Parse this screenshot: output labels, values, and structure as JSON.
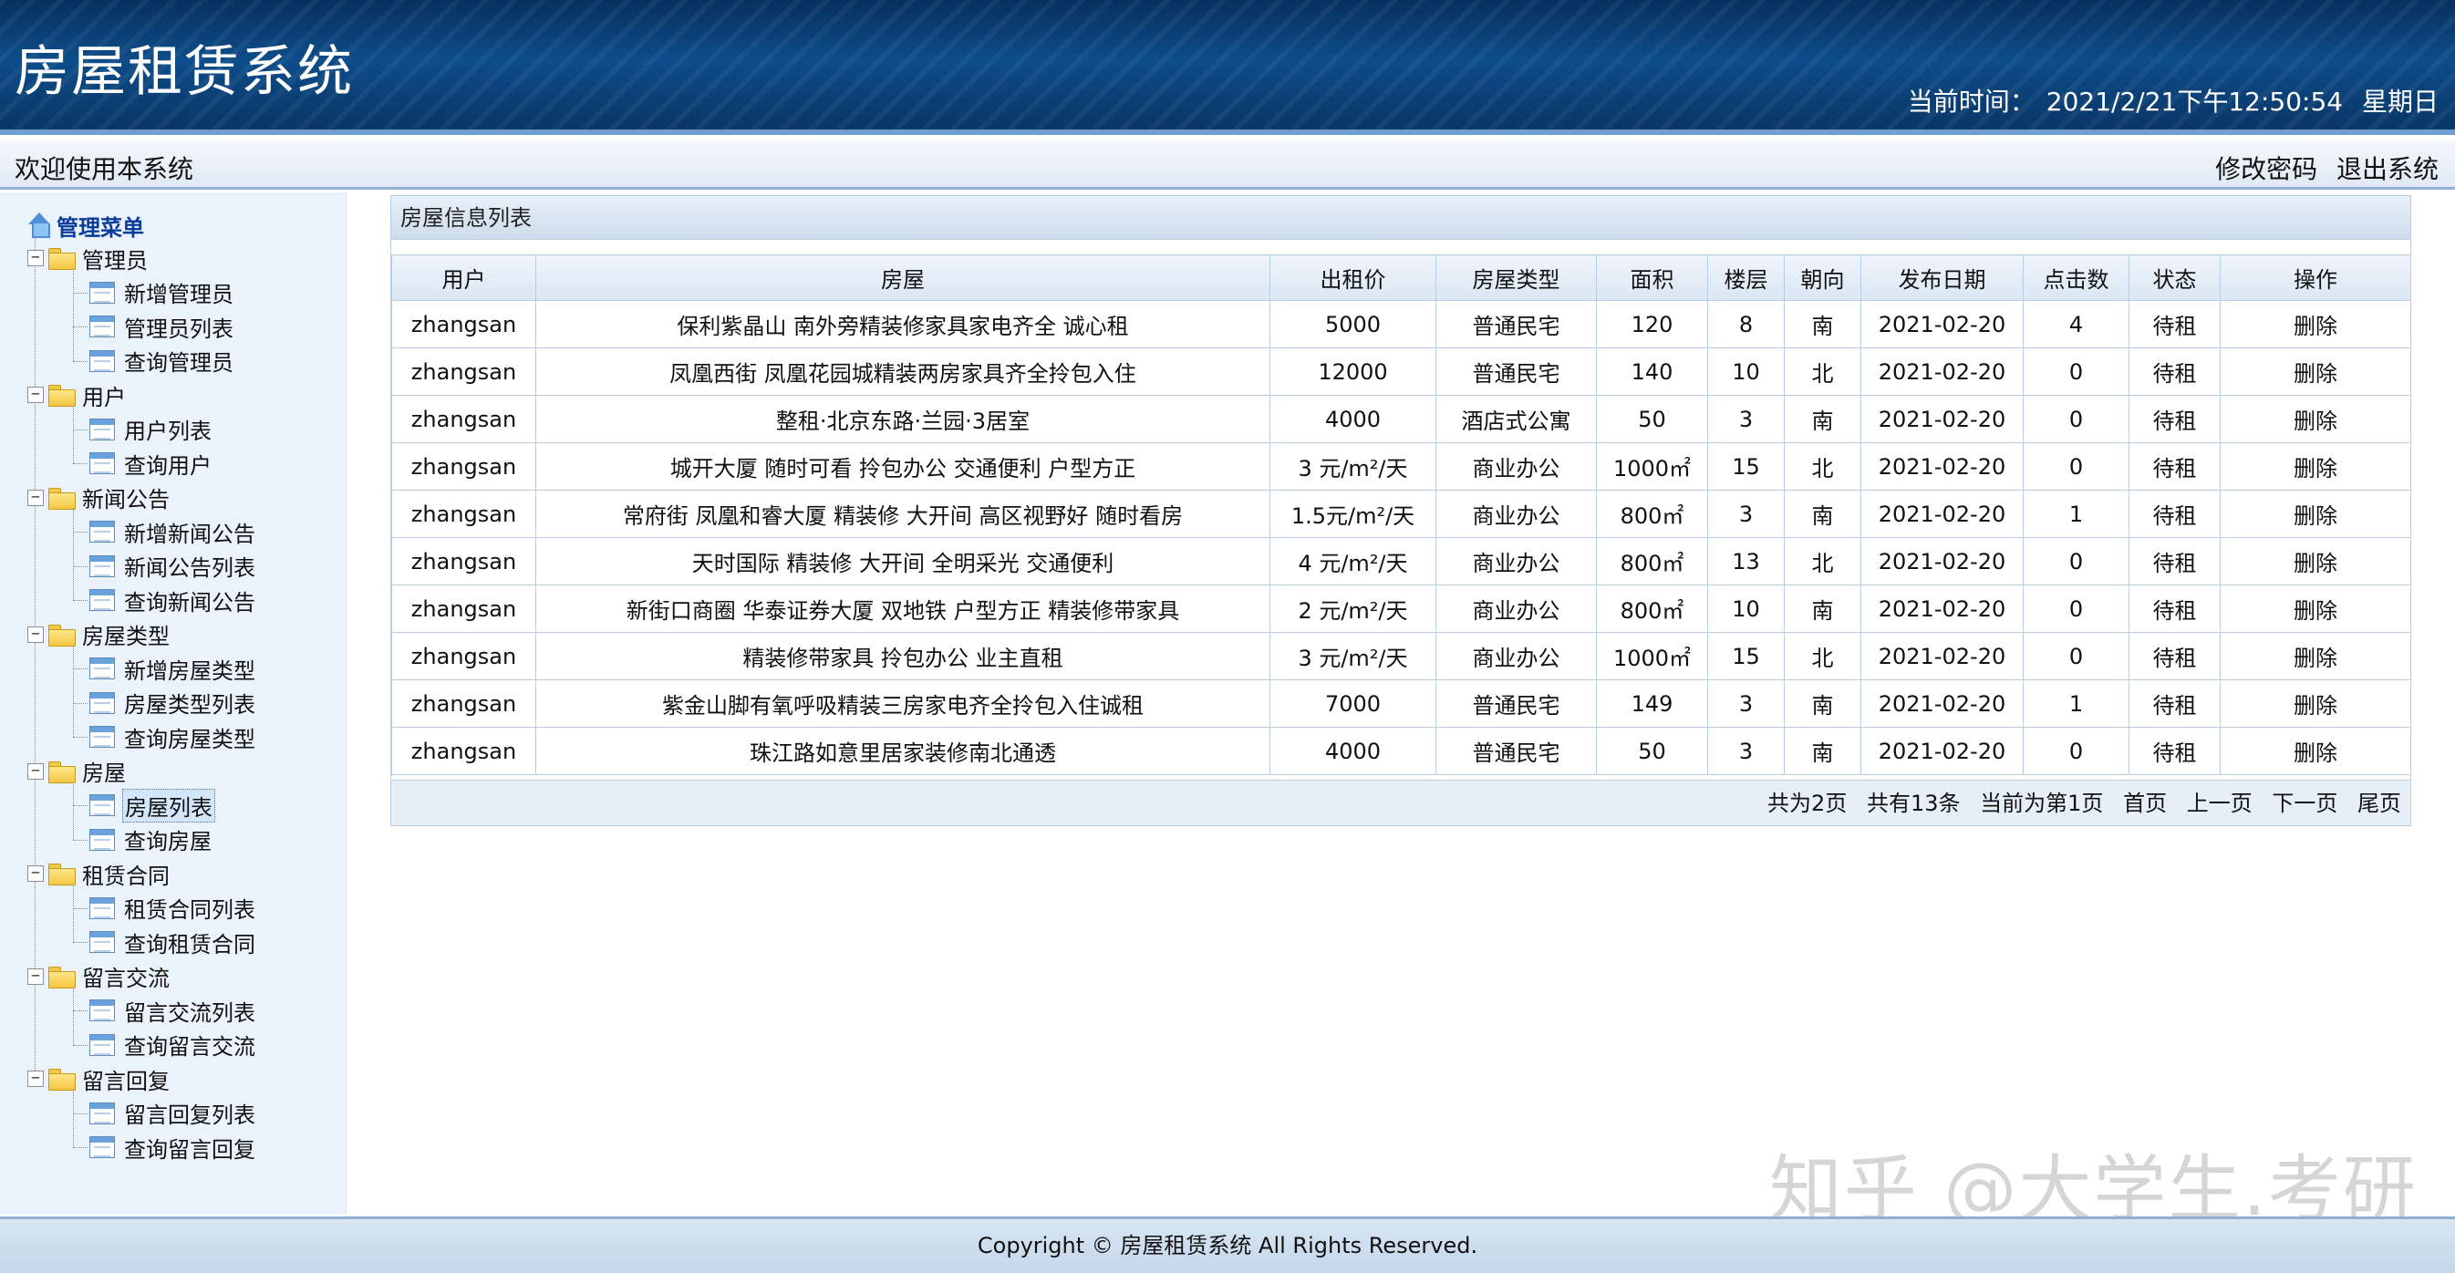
{
  "header": {
    "title": "房屋租赁系统",
    "clock_label": "当前时间：",
    "clock_value": "2021/2/21下午12:50:54",
    "clock_weekday": "星期日"
  },
  "welcome": {
    "text": "欢迎使用本系统",
    "change_password": "修改密码",
    "logout": "退出系统"
  },
  "sidebar": {
    "root_label": "管理菜单",
    "categories": [
      {
        "label": "管理员",
        "items": [
          "新增管理员",
          "管理员列表",
          "查询管理员"
        ]
      },
      {
        "label": "用户",
        "items": [
          "用户列表",
          "查询用户"
        ]
      },
      {
        "label": "新闻公告",
        "items": [
          "新增新闻公告",
          "新闻公告列表",
          "查询新闻公告"
        ]
      },
      {
        "label": "房屋类型",
        "items": [
          "新增房屋类型",
          "房屋类型列表",
          "查询房屋类型"
        ]
      },
      {
        "label": "房屋",
        "items": [
          "房屋列表",
          "查询房屋"
        ]
      },
      {
        "label": "租赁合同",
        "items": [
          "租赁合同列表",
          "查询租赁合同"
        ]
      },
      {
        "label": "留言交流",
        "items": [
          "留言交流列表",
          "查询留言交流"
        ]
      },
      {
        "label": "留言回复",
        "items": [
          "留言回复列表",
          "查询留言回复"
        ]
      }
    ],
    "selected": "房屋列表"
  },
  "panel": {
    "title": "房屋信息列表",
    "columns": [
      "用户",
      "房屋",
      "出租价",
      "房屋类型",
      "面积",
      "楼层",
      "朝向",
      "发布日期",
      "点击数",
      "状态",
      "操作"
    ],
    "rows": [
      [
        "zhangsan",
        "保利紫晶山 南外旁精装修家具家电齐全 诚心租",
        "5000",
        "普通民宅",
        "120",
        "8",
        "南",
        "2021-02-20",
        "4",
        "待租",
        "删除"
      ],
      [
        "zhangsan",
        "凤凰西街 凤凰花园城精装两房家具齐全拎包入住",
        "12000",
        "普通民宅",
        "140",
        "10",
        "北",
        "2021-02-20",
        "0",
        "待租",
        "删除"
      ],
      [
        "zhangsan",
        "整租·北京东路·兰园·3居室",
        "4000",
        "酒店式公寓",
        "50",
        "3",
        "南",
        "2021-02-20",
        "0",
        "待租",
        "删除"
      ],
      [
        "zhangsan",
        "城开大厦 随时可看 拎包办公 交通便利 户型方正",
        "3 元/m²/天",
        "商业办公",
        "1000㎡",
        "15",
        "北",
        "2021-02-20",
        "0",
        "待租",
        "删除"
      ],
      [
        "zhangsan",
        "常府街 凤凰和睿大厦 精装修 大开间 高区视野好 随时看房",
        "1.5元/m²/天",
        "商业办公",
        "800㎡",
        "3",
        "南",
        "2021-02-20",
        "1",
        "待租",
        "删除"
      ],
      [
        "zhangsan",
        "天时国际 精装修 大开间 全明采光 交通便利",
        "4 元/m²/天",
        "商业办公",
        "800㎡",
        "13",
        "北",
        "2021-02-20",
        "0",
        "待租",
        "删除"
      ],
      [
        "zhangsan",
        "新街口商圈 华泰证券大厦 双地铁 户型方正 精装修带家具",
        "2 元/m²/天",
        "商业办公",
        "800㎡",
        "10",
        "南",
        "2021-02-20",
        "0",
        "待租",
        "删除"
      ],
      [
        "zhangsan",
        "精装修带家具 拎包办公 业主直租",
        "3 元/m²/天",
        "商业办公",
        "1000㎡",
        "15",
        "北",
        "2021-02-20",
        "0",
        "待租",
        "删除"
      ],
      [
        "zhangsan",
        "紫金山脚有氧呼吸精装三房家电齐全拎包入住诚租",
        "7000",
        "普通民宅",
        "149",
        "3",
        "南",
        "2021-02-20",
        "1",
        "待租",
        "删除"
      ],
      [
        "zhangsan",
        "珠江路如意里居家装修南北通透",
        "4000",
        "普通民宅",
        "50",
        "3",
        "南",
        "2021-02-20",
        "0",
        "待租",
        "删除"
      ]
    ],
    "pager": {
      "total_pages": "共为2页",
      "total_records": "共有13条",
      "current_page": "当前为第1页",
      "first": "首页",
      "prev": "上一页",
      "next": "下一页",
      "last": "尾页"
    }
  },
  "watermark": "知乎 @大学生.考研",
  "footer": {
    "copyright": "Copyright © 房屋租赁系统 All Rights Reserved."
  },
  "colors": {
    "header_dark": "#08305f",
    "header_mid": "#0d4d8a",
    "accent_border": "#8fb0d4",
    "grid_border": "#b9cde3"
  }
}
